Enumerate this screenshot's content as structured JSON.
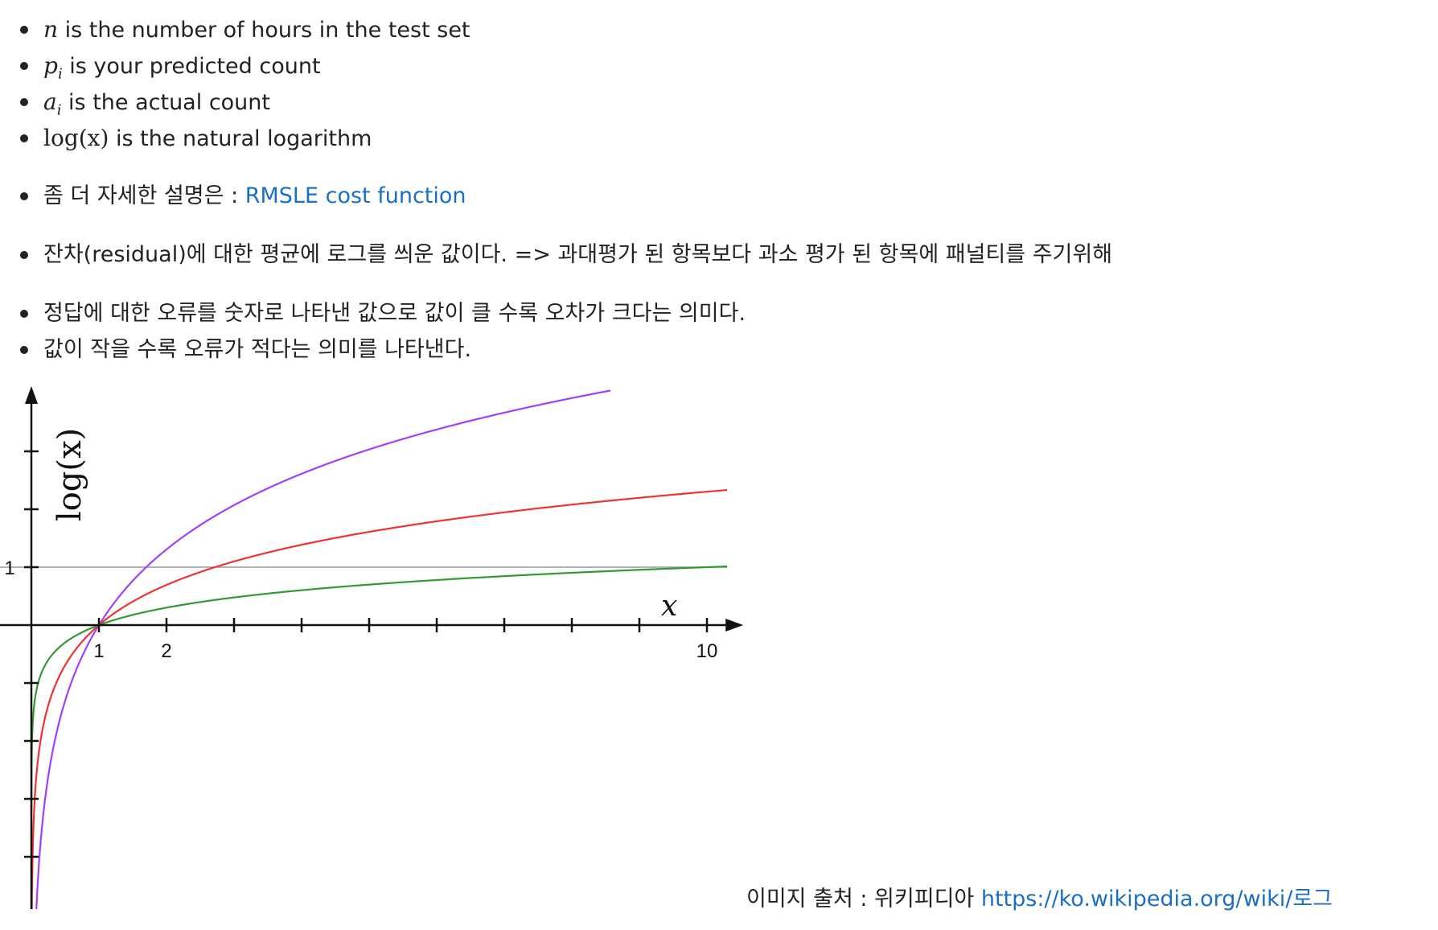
{
  "definitions": [
    {
      "symbol": "n",
      "text": " is the number of hours in the test set"
    },
    {
      "symbol": "p",
      "sub": "i",
      "text": " is your predicted count"
    },
    {
      "symbol": "a",
      "sub": "i",
      "text": " is the actual count"
    },
    {
      "symbol": "log(x)",
      "text": " is the natural logarithm"
    }
  ],
  "detail": {
    "prefix": "좀 더 자세한 설명은 : ",
    "link_label": "RMSLE cost function"
  },
  "residual_note": "잔차(residual)에 대한 평균에 로그를 씌운 값이다. => 과대평가 된 항목보다 과소 평가 된 항목에 패널티를 주기위해",
  "meaning": [
    "정답에 대한 오류를 숫자로 나타낸 값으로 값이 클 수록 오차가 크다는 의미다.",
    "값이 작을 수록 오류가 적다는 의미를 나타낸다."
  ],
  "chart_data": {
    "type": "line",
    "ylabel": "log(x)",
    "xlabel": "x",
    "xlim": [
      0,
      10.3
    ],
    "ylim": [
      -5,
      4
    ],
    "x_tick_labels": [
      "1",
      "2",
      "10"
    ],
    "y_tick_labels": [
      "1"
    ],
    "reference_line": {
      "y": 1,
      "color": "#999999"
    },
    "series": [
      {
        "base": 1.7,
        "color": "#a040ff"
      },
      {
        "base": 2.718,
        "color": "#ee3333"
      },
      {
        "base": 10,
        "color": "#339933"
      }
    ]
  },
  "caption": {
    "prefix": "이미지 출처 : 위키피디아 ",
    "link_label": "https://ko.wikipedia.org/wiki/로그"
  },
  "colors": {
    "text": "#222222",
    "link": "#1a6fc6"
  }
}
